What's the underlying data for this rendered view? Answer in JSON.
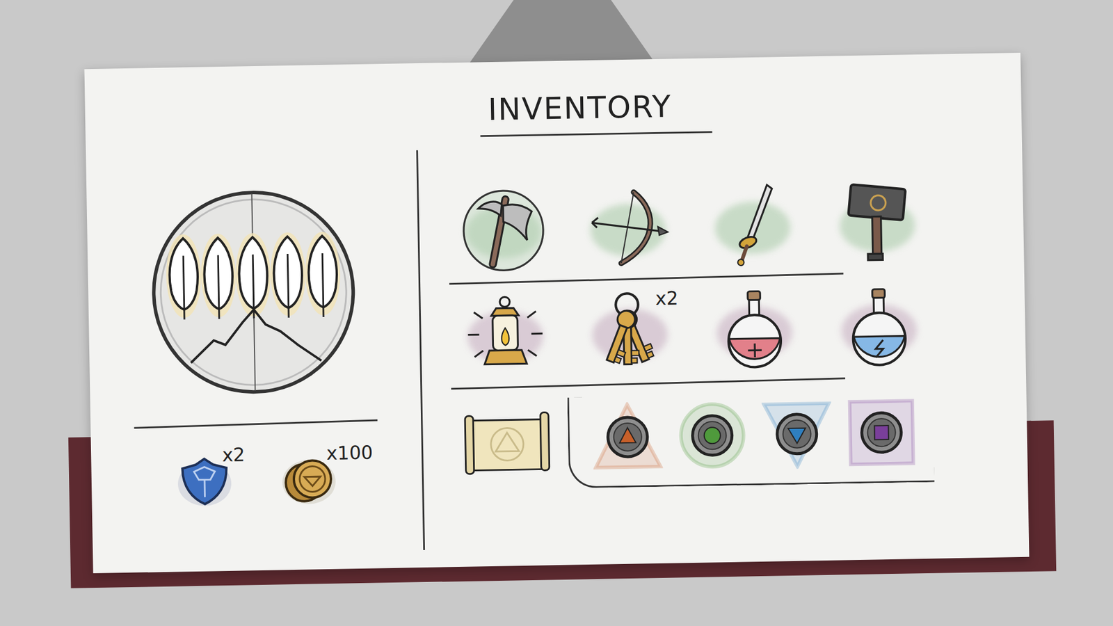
{
  "title": "INVENTORY",
  "emblem": {
    "leaves": 5
  },
  "weapons": [
    {
      "kind": "axe",
      "selected": true
    },
    {
      "kind": "bow",
      "selected": false
    },
    {
      "kind": "sword",
      "selected": false
    },
    {
      "kind": "hammer",
      "selected": false
    }
  ],
  "items": [
    {
      "kind": "lantern"
    },
    {
      "kind": "keys",
      "count": "x2"
    },
    {
      "kind": "health-potion",
      "color": "#e2808a"
    },
    {
      "kind": "energy-potion",
      "color": "#86b8e6"
    }
  ],
  "map": {
    "kind": "scroll"
  },
  "runes": [
    {
      "kind": "triangle",
      "color": "#c8602a"
    },
    {
      "kind": "circle",
      "color": "#4f9a3c"
    },
    {
      "kind": "triangle-down",
      "color": "#2f7fc0"
    },
    {
      "kind": "square",
      "color": "#7a3f9a"
    }
  ],
  "currency": [
    {
      "kind": "shield",
      "count": "x2"
    },
    {
      "kind": "coin",
      "count": "x100"
    }
  ]
}
